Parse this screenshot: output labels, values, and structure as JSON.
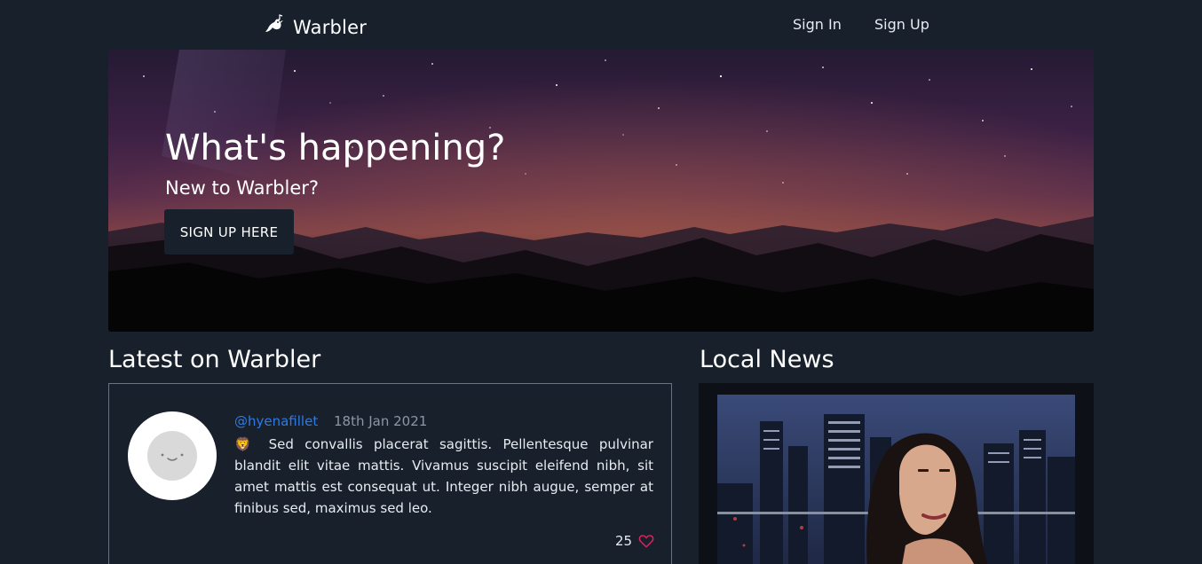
{
  "navbar": {
    "brand_name": "Warbler",
    "brand_icon": "bird-icon",
    "sign_in": "Sign In",
    "sign_up": "Sign Up"
  },
  "hero": {
    "title": "What's happening?",
    "subtitle": "New to Warbler?",
    "button_label": "SIGN UP HERE"
  },
  "latest": {
    "title": "Latest on Warbler",
    "posts": [
      {
        "handle": "@hyenafillet",
        "date": "18th Jan 2021",
        "emoji": "🦁",
        "body": "Sed convallis placerat sagittis. Pellentesque pulvinar blandit elit vitae mattis. Vivamus suscipit eleifend nibh, sit amet mattis est consequat ut. Integer nibh augue, semper at finibus sed, maximus sed leo.",
        "likes": "25",
        "like_icon": "heart-icon"
      }
    ]
  },
  "news": {
    "title": "Local News"
  },
  "colors": {
    "background": "#17202b",
    "handle": "#2e7ae6",
    "heart": "#e0245e"
  }
}
